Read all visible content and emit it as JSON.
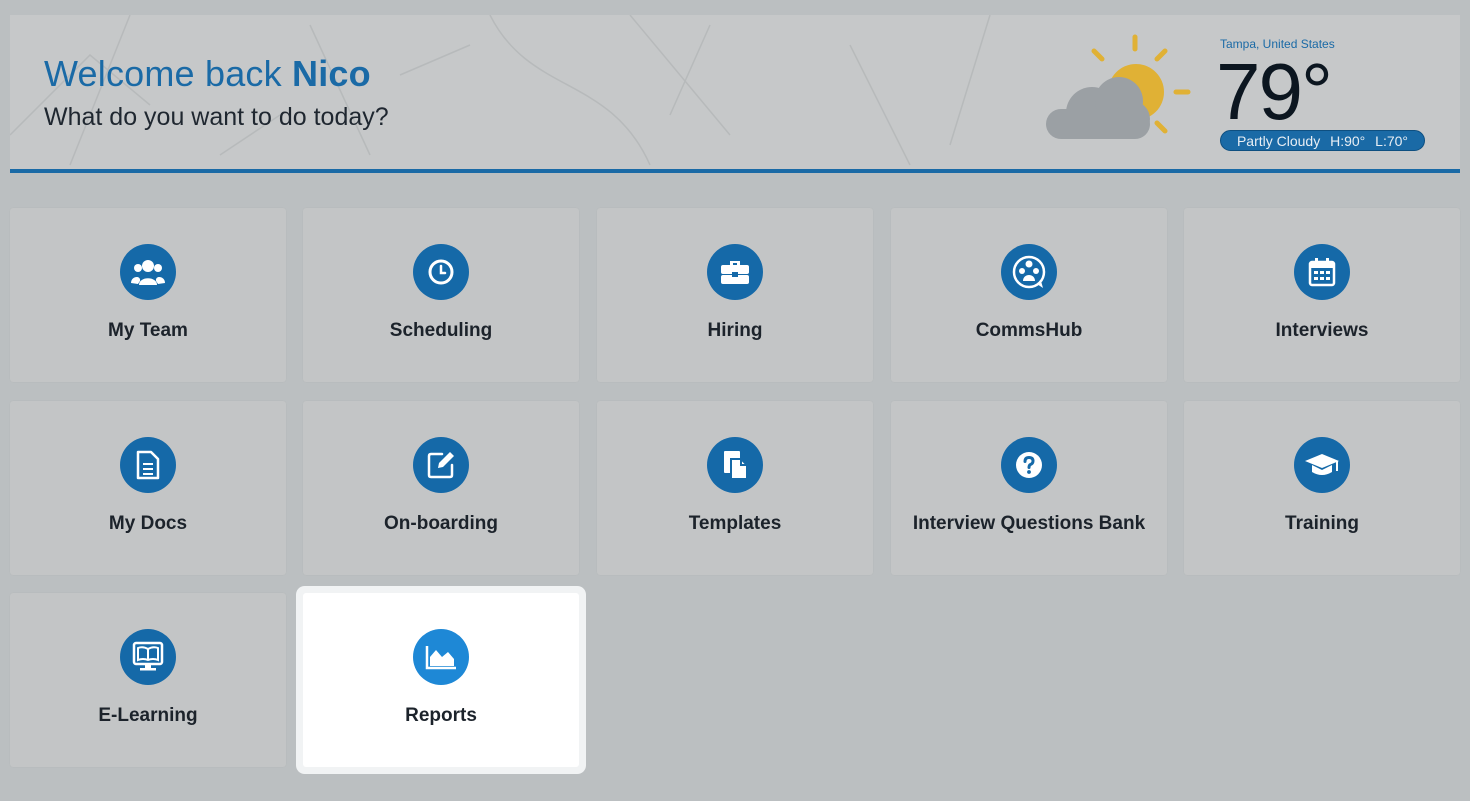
{
  "header": {
    "welcome_prefix": "Welcome back",
    "user_name": "Nico",
    "subtitle": "What do you want to do today?"
  },
  "weather": {
    "location": "Tampa, United States",
    "temperature": "79°",
    "condition": "Partly Cloudy",
    "high": "H:90°",
    "low": "L:70°",
    "icon": "partly-cloudy-icon"
  },
  "tiles": [
    {
      "label": "My Team",
      "icon": "team-icon"
    },
    {
      "label": "Scheduling",
      "icon": "clock-icon"
    },
    {
      "label": "Hiring",
      "icon": "briefcase-icon"
    },
    {
      "label": "CommsHub",
      "icon": "chat-icon"
    },
    {
      "label": "Interviews",
      "icon": "calendar-icon"
    },
    {
      "label": "My Docs",
      "icon": "document-icon"
    },
    {
      "label": "On-boarding",
      "icon": "edit-icon"
    },
    {
      "label": "Templates",
      "icon": "template-icon"
    },
    {
      "label": "Interview Questions Bank",
      "icon": "question-icon"
    },
    {
      "label": "Training",
      "icon": "graduation-cap-icon"
    },
    {
      "label": "E-Learning",
      "icon": "monitor-book-icon"
    },
    {
      "label": "Reports",
      "icon": "chart-icon"
    }
  ],
  "colors": {
    "brand": "#1a6aa6",
    "active_icon": "#1e88d6",
    "sun": "#e0b135",
    "cloud": "#9ba0a4"
  }
}
